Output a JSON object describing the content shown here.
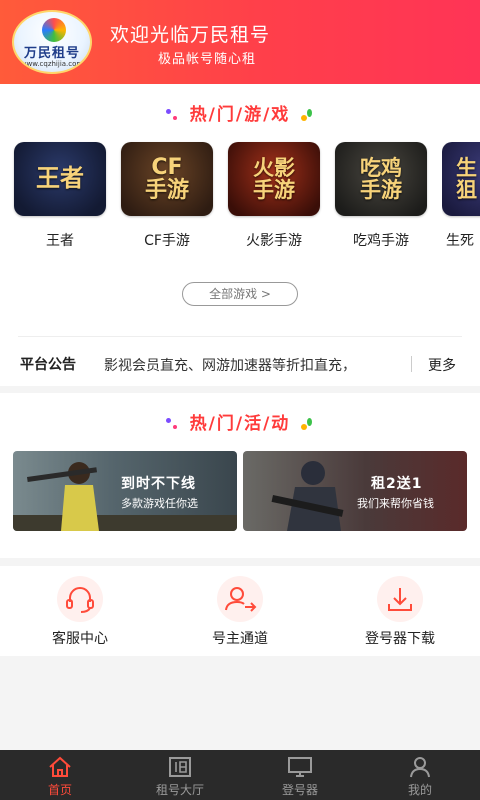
{
  "header": {
    "logo_text": "万民租号",
    "logo_url": "www.cqzhijia.com",
    "welcome": "欢迎光临万民租号",
    "slogan": "极品帐号随心租"
  },
  "hot_games": {
    "title": "热/门/游/戏",
    "items": [
      {
        "tile_lines": [
          "王者"
        ],
        "name": "王者",
        "bg": "#1a2240"
      },
      {
        "tile_lines": [
          "CF",
          "手游"
        ],
        "name": "CF手游",
        "bg": "#3a2418"
      },
      {
        "tile_lines": [
          "火影",
          "手游"
        ],
        "name": "火影手游",
        "bg": "#5a1a10"
      },
      {
        "tile_lines": [
          "吃鸡",
          "手游"
        ],
        "name": "吃鸡手游",
        "bg": "#2a2a26"
      },
      {
        "tile_lines": [
          "生",
          "狙"
        ],
        "name": "生死",
        "bg": "#2a2a5a"
      }
    ],
    "all_games_label": "全部游戏 >"
  },
  "notice": {
    "label": "平台公告",
    "text": "影视会员直充、网游加速器等折扣直充，",
    "more": "更多"
  },
  "hot_activities": {
    "title": "热/门/活/动",
    "banners": [
      {
        "title": "到时不下线",
        "subtitle": "多款游戏任你选"
      },
      {
        "title": "租2送1",
        "subtitle": "我们来帮你省钱"
      }
    ]
  },
  "services": [
    {
      "icon": "headset-icon",
      "label": "客服中心"
    },
    {
      "icon": "user-transfer-icon",
      "label": "号主通道"
    },
    {
      "icon": "download-icon",
      "label": "登号器下载"
    }
  ],
  "bottom_nav": [
    {
      "icon": "home-icon",
      "label": "首页",
      "active": true
    },
    {
      "icon": "rent-hall-icon",
      "label": "租号大厅",
      "active": false
    },
    {
      "icon": "monitor-icon",
      "label": "登号器",
      "active": false
    },
    {
      "icon": "profile-icon",
      "label": "我的",
      "active": false
    }
  ],
  "colors": {
    "accent": "#ff4b3a",
    "header_gradient_start": "#ff5b3a",
    "header_gradient_end": "#ff3456",
    "nav_bg": "#2a2a2a"
  }
}
